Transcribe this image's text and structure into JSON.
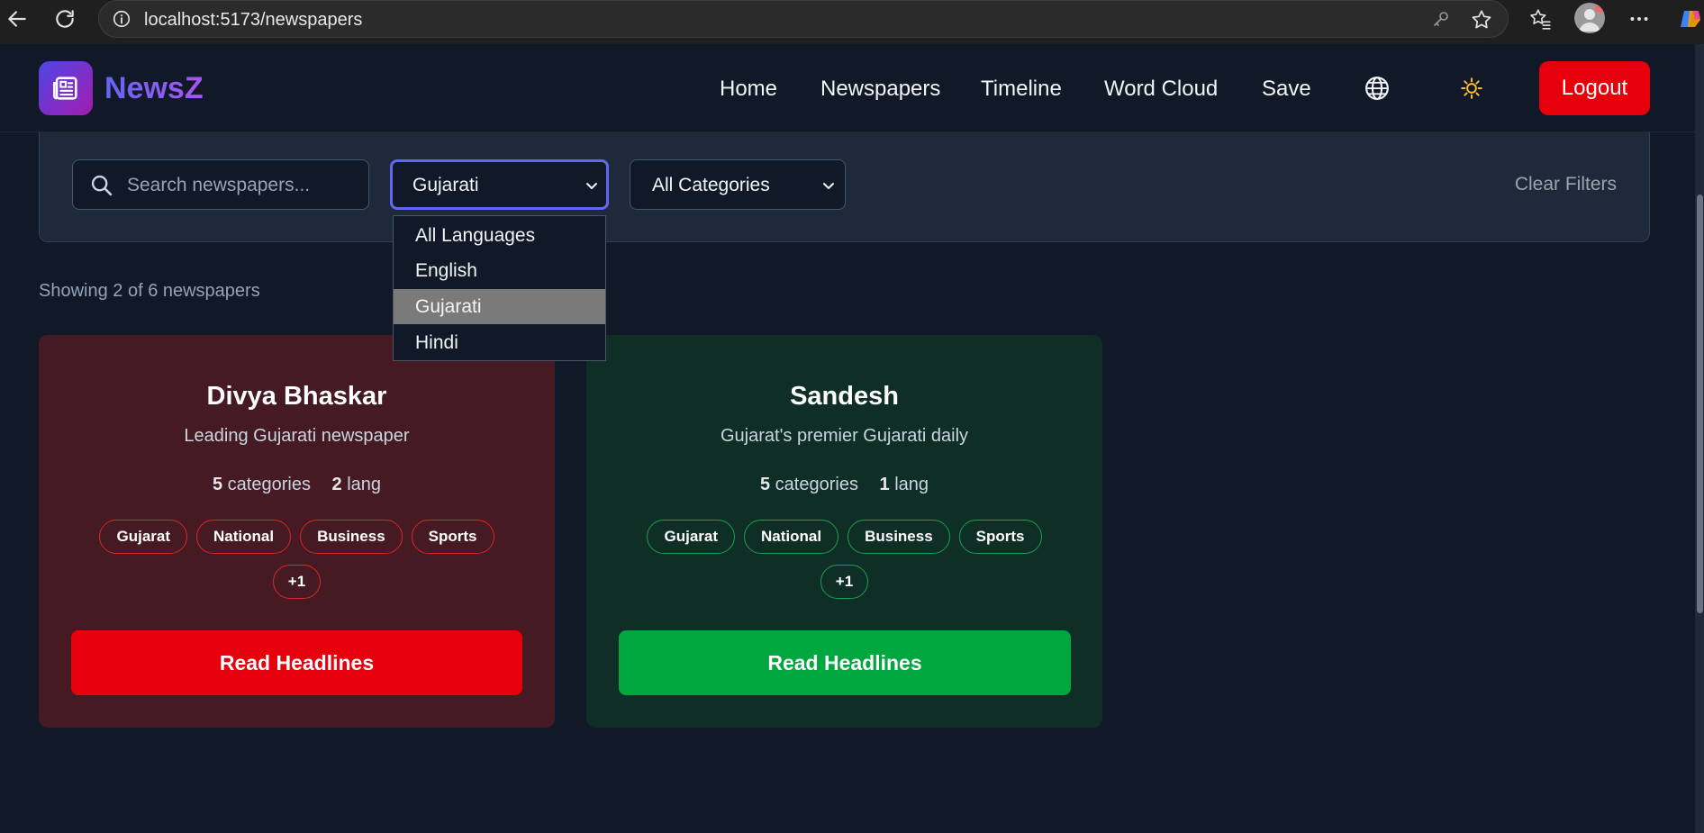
{
  "browser": {
    "url": "localhost:5173/newspapers"
  },
  "header": {
    "app_name": "NewsZ",
    "nav": [
      {
        "label": "Home"
      },
      {
        "label": "Newspapers"
      },
      {
        "label": "Timeline"
      },
      {
        "label": "Word Cloud"
      },
      {
        "label": "Save"
      }
    ],
    "logout_label": "Logout"
  },
  "filters": {
    "search_placeholder": "Search newspapers...",
    "language_value": "Gujarati",
    "category_value": "All Categories",
    "clear_label": "Clear Filters",
    "language_options": [
      "All Languages",
      "English",
      "Gujarati",
      "Hindi"
    ],
    "language_selected_index": 2
  },
  "results": {
    "showing_text": "Showing 2 of 6 newspapers"
  },
  "cards": [
    {
      "title": "Divya Bhaskar",
      "description": "Leading Gujarati newspaper",
      "categories_count": "5",
      "categories_label": "categories",
      "lang_count": "2",
      "lang_label": "lang",
      "tags": [
        "Gujarat",
        "National",
        "Business",
        "Sports"
      ],
      "more_tag": "+1",
      "button_label": "Read Headlines",
      "theme_color": "#e7000b"
    },
    {
      "title": "Sandesh",
      "description": "Gujarat's premier Gujarati daily",
      "categories_count": "5",
      "categories_label": "categories",
      "lang_count": "1",
      "lang_label": "lang",
      "tags": [
        "Gujarat",
        "National",
        "Business",
        "Sports"
      ],
      "more_tag": "+1",
      "button_label": "Read Headlines",
      "theme_color": "#00a63e"
    }
  ],
  "colors": {
    "background": "#111827",
    "accent": "#6366f1",
    "logout": "#e7000b"
  },
  "icons": {
    "back": "arrow-left-icon",
    "refresh": "refresh-icon",
    "info": "info-icon",
    "key": "key-icon",
    "star": "star-icon",
    "favorites": "favorites-icon",
    "more": "more-icon",
    "logo": "newspaper-icon",
    "language": "globe-icon",
    "theme": "sun-icon",
    "search": "search-icon"
  }
}
